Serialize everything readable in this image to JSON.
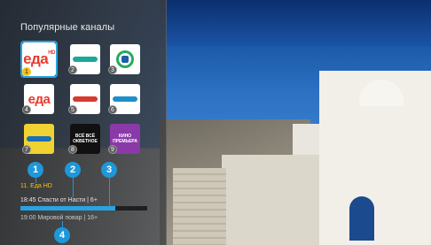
{
  "panel": {
    "title": "Популярные каналы"
  },
  "channels": [
    {
      "number": "1",
      "logo": "еда",
      "logo_sup": "HD",
      "bg": "#ffffff",
      "selected": true
    },
    {
      "number": "2",
      "logo": "",
      "bg": "#ffffff",
      "selected": false
    },
    {
      "number": "3",
      "logo": "",
      "bg": "#ffffff",
      "selected": false
    },
    {
      "number": "4",
      "logo": "еда",
      "bg": "#ffffff",
      "selected": false
    },
    {
      "number": "5",
      "logo": "",
      "bg": "#ffffff",
      "selected": false
    },
    {
      "number": "6",
      "logo": "",
      "bg": "#ffffff",
      "selected": false
    },
    {
      "number": "7",
      "logo": "",
      "bg": "#f0d232",
      "selected": false
    },
    {
      "number": "8",
      "logo": "ВСЁ ВСЁ ОКВЕТНОЕ",
      "bg": "#111111",
      "selected": false
    },
    {
      "number": "9",
      "logo": "КИНО ПРЕМЬЕРА",
      "bg": "#8a3aa8",
      "selected": false
    }
  ],
  "now_playing": {
    "channel": "11. Еда HD",
    "current": "18:45 Спасти от Насти | 6+",
    "progress": 0.75,
    "next": "19:00 Мировой повар | 16+"
  },
  "callouts": [
    "1",
    "2",
    "3",
    "4"
  ],
  "colors": {
    "accent": "#2aa3e0",
    "callout": "#1f97d9",
    "highlight": "#f0c419"
  }
}
